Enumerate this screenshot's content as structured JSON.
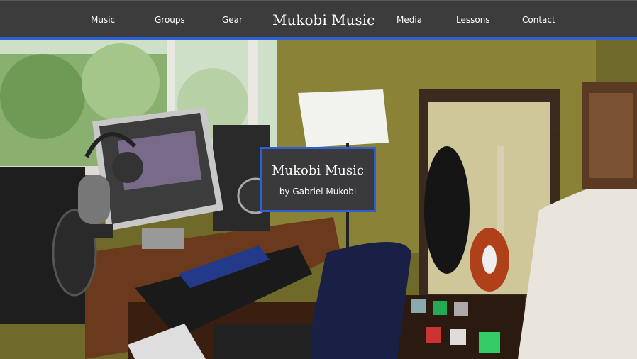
{
  "nav": {
    "left_items": [
      {
        "label": "Music"
      },
      {
        "label": "Groups"
      },
      {
        "label": "Gear"
      }
    ],
    "brand": "Mukobi Music",
    "right_items": [
      {
        "label": "Media"
      },
      {
        "label": "Lessons"
      },
      {
        "label": "Contact"
      }
    ]
  },
  "hero": {
    "title": "Mukobi Music",
    "subtitle": "by Gabriel Mukobi"
  },
  "colors": {
    "nav_bg": "#3c3c3c",
    "accent": "#2f5fd0",
    "overlay_bg": "#3a3a3c"
  }
}
